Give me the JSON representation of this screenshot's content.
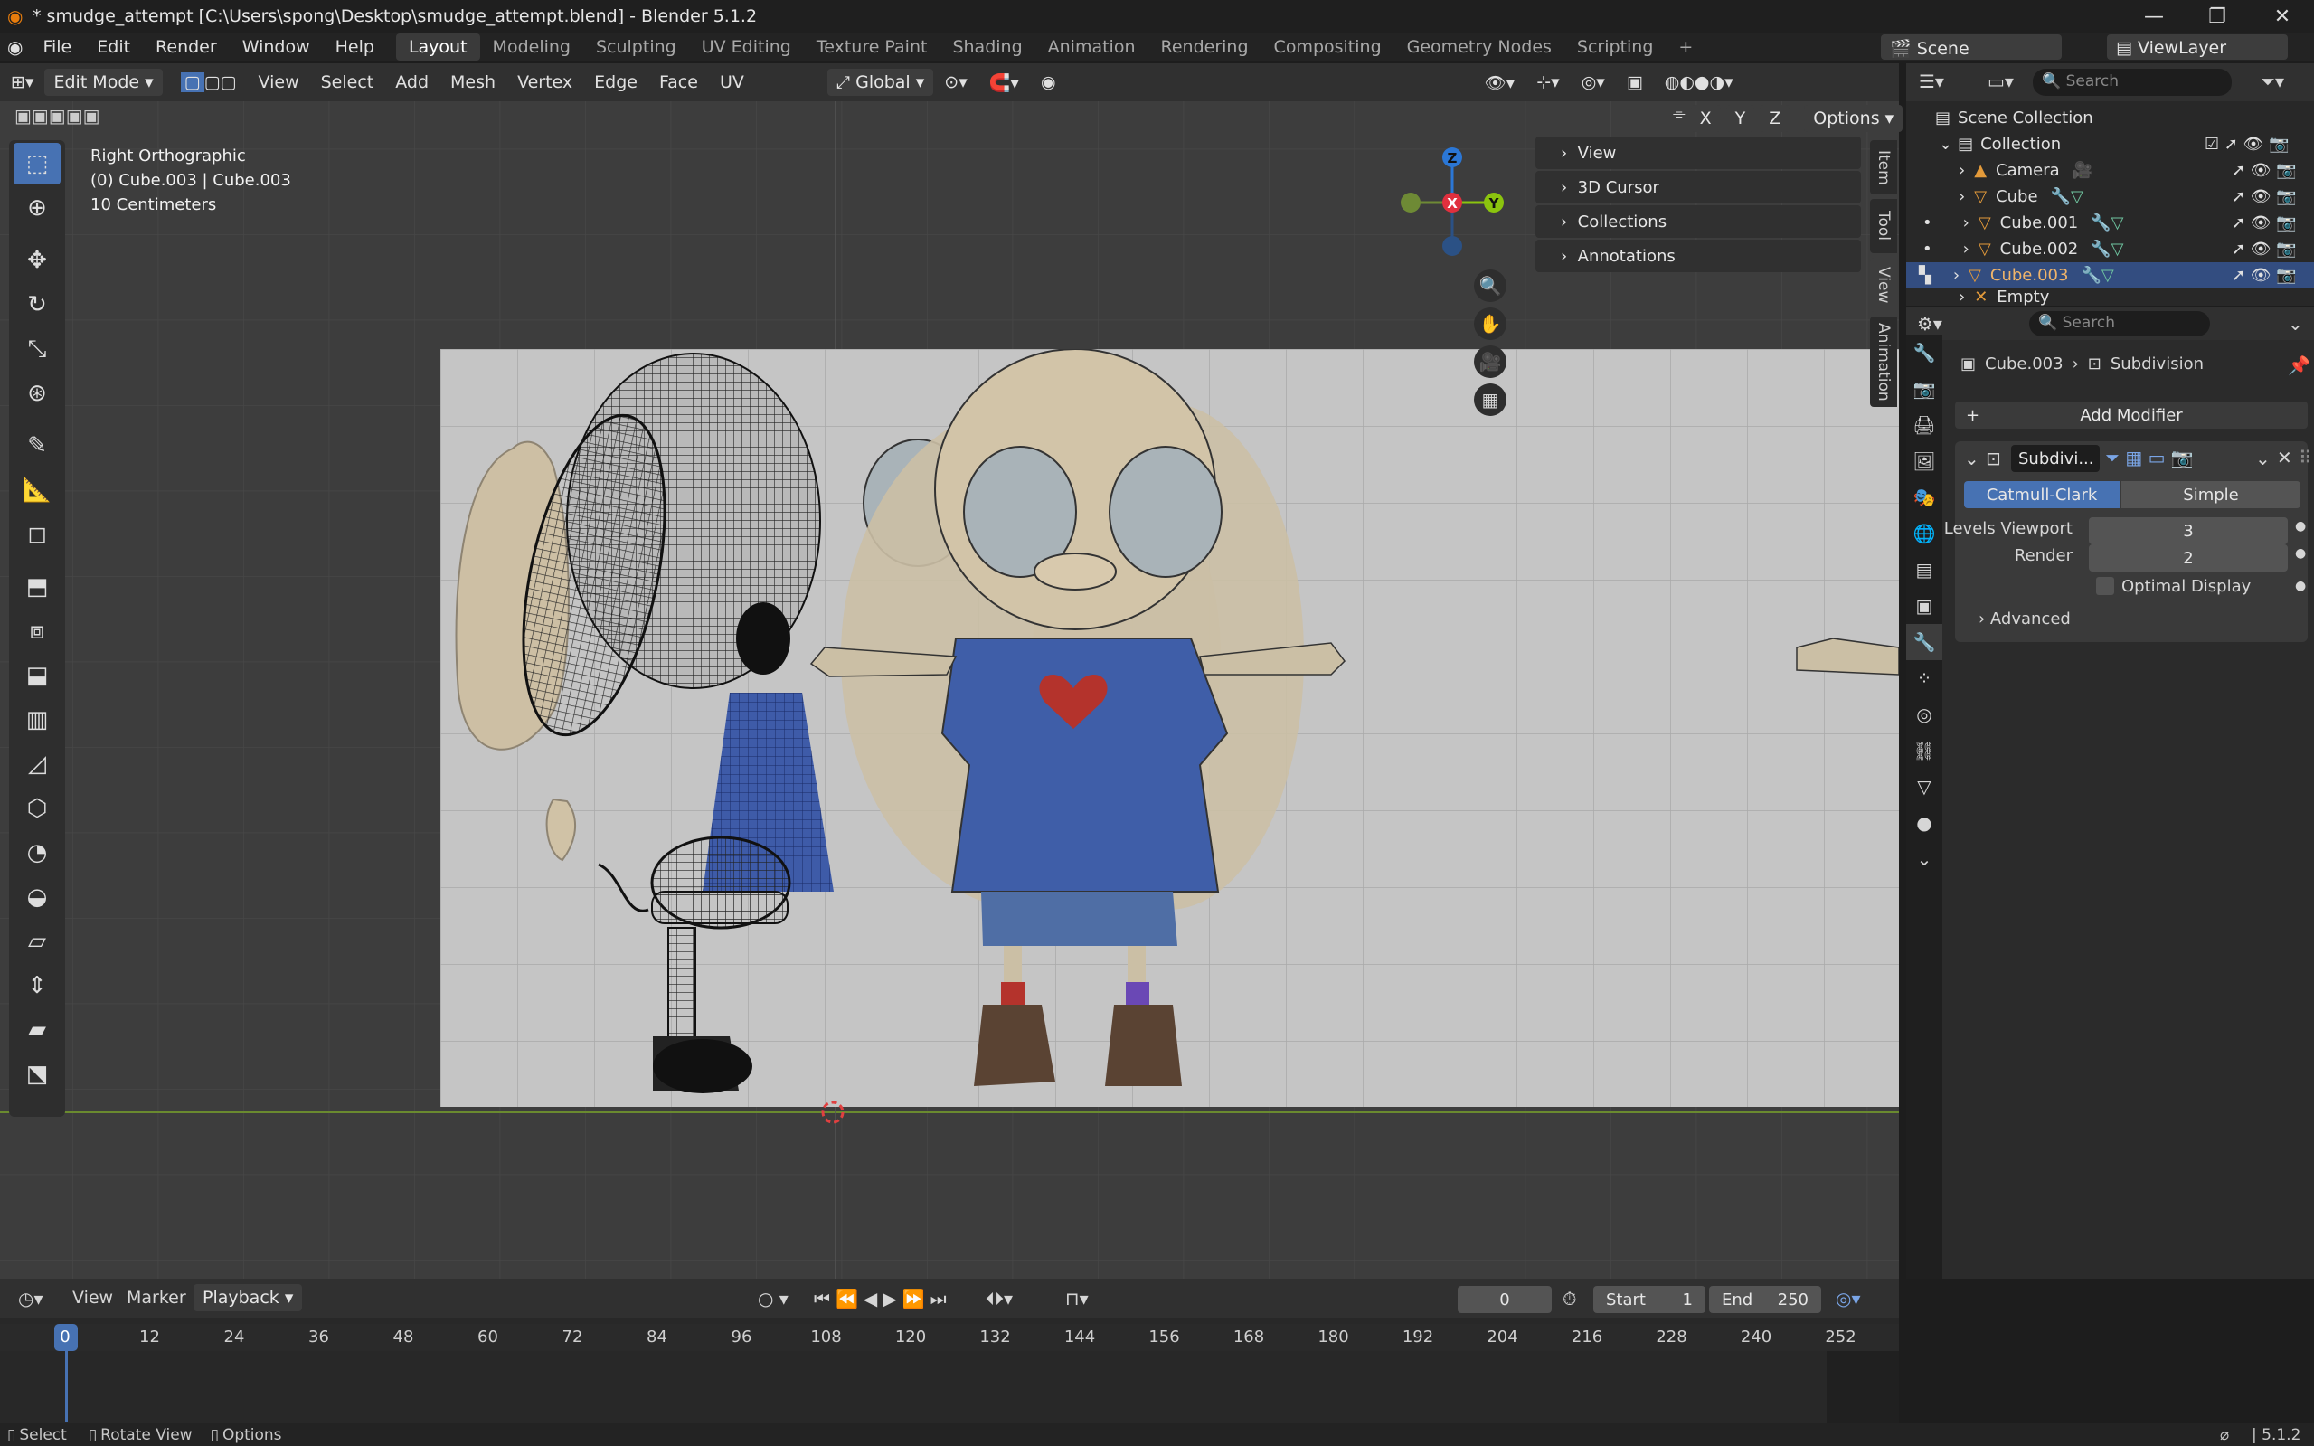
{
  "window": {
    "title": "* smudge_attempt [C:\\Users\\spong\\Desktop\\smudge_attempt.blend] - Blender 5.1.2"
  },
  "menus": [
    "File",
    "Edit",
    "Render",
    "Window",
    "Help"
  ],
  "workspaces": [
    "Layout",
    "Modeling",
    "Sculpting",
    "UV Editing",
    "Texture Paint",
    "Shading",
    "Animation",
    "Rendering",
    "Compositing",
    "Geometry Nodes",
    "Scripting"
  ],
  "active_workspace": "Layout",
  "scene": {
    "name": "Scene",
    "view_layer": "ViewLayer"
  },
  "viewport_header": {
    "mode": "Edit Mode",
    "menus": [
      "View",
      "Select",
      "Add",
      "Mesh",
      "Vertex",
      "Edge",
      "Face",
      "UV"
    ],
    "orientation": "Global",
    "options_label": "Options",
    "axes": [
      "X",
      "Y",
      "Z"
    ]
  },
  "overlay": {
    "view_name": "Right Orthographic",
    "object_info": "(0) Cube.003 | Cube.003",
    "scale": "10 Centimeters"
  },
  "gizmo": {
    "z": "Z",
    "x": "X",
    "y": "Y"
  },
  "npanel": {
    "sections": [
      "View",
      "3D Cursor",
      "Collections",
      "Annotations"
    ],
    "tabs": [
      "Item",
      "Tool",
      "View",
      "Animation"
    ]
  },
  "outliner": {
    "search_placeholder": "Search",
    "scene_collection": "Scene Collection",
    "collection": "Collection",
    "items": [
      "Camera",
      "Cube",
      "Cube.001",
      "Cube.002",
      "Cube.003",
      "Empty"
    ],
    "selected": "Cube.003"
  },
  "properties": {
    "search_placeholder": "Search",
    "breadcrumb_object": "Cube.003",
    "breadcrumb_modifier": "Subdivision",
    "add_modifier": "Add Modifier",
    "modifier_name": "Subdivi...",
    "type_options": [
      "Catmull-Clark",
      "Simple"
    ],
    "active_type": "Catmull-Clark",
    "levels_viewport_label": "Levels Viewport",
    "levels_viewport": "3",
    "render_label": "Render",
    "render": "2",
    "optimal_display": "Optimal Display",
    "advanced": "Advanced"
  },
  "timeline": {
    "menus": [
      "View",
      "Marker",
      "Playback"
    ],
    "current_frame": "0",
    "start_label": "Start",
    "start": "1",
    "end_label": "End",
    "end": "250",
    "ticks": [
      "0",
      "12",
      "24",
      "36",
      "48",
      "60",
      "72",
      "84",
      "96",
      "108",
      "120",
      "132",
      "144",
      "156",
      "168",
      "180",
      "192",
      "204",
      "216",
      "228",
      "240",
      "252"
    ]
  },
  "statusbar": {
    "select": "Select",
    "rotate": "Rotate View",
    "options": "Options",
    "version": "5.1.2"
  },
  "colors": {
    "accent": "#4772b3",
    "selected_row": "#334d80",
    "viewport_bg": "#3d3d3d",
    "x_axis": "#e0303e",
    "y_axis": "#8bc40e",
    "z_axis": "#2b77d6"
  }
}
